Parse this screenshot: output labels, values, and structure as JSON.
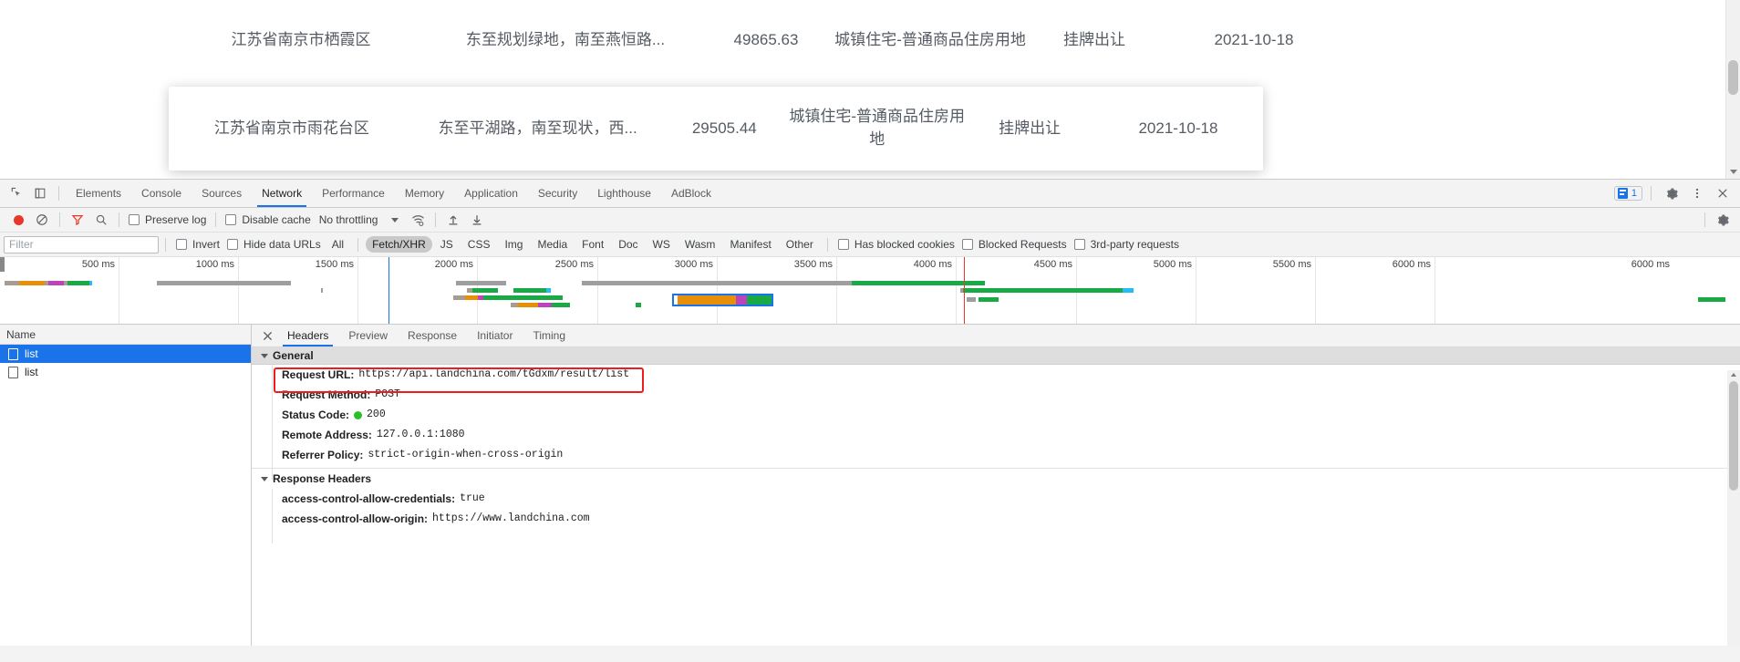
{
  "page": {
    "table": {
      "rows": [
        {
          "region": "江苏省南京市栖霞区",
          "description": "东至规划绿地，南至燕恒路...",
          "area": "49865.63",
          "usage": "城镇住宅-普通商品住房用地",
          "way": "挂牌出让",
          "date": "2021-10-18"
        },
        {
          "region": "江苏省南京市雨花台区",
          "description": "东至平湖路，南至现状，西...",
          "area": "29505.44",
          "usage": "城镇住宅-普通商品住房用地",
          "way": "挂牌出让",
          "date": "2021-10-18"
        }
      ]
    }
  },
  "devtools": {
    "tabs": [
      {
        "label": "Elements",
        "active": false
      },
      {
        "label": "Console",
        "active": false
      },
      {
        "label": "Sources",
        "active": false
      },
      {
        "label": "Network",
        "active": true
      },
      {
        "label": "Performance",
        "active": false
      },
      {
        "label": "Memory",
        "active": false
      },
      {
        "label": "Application",
        "active": false
      },
      {
        "label": "Security",
        "active": false
      },
      {
        "label": "Lighthouse",
        "active": false
      },
      {
        "label": "AdBlock",
        "active": false
      }
    ],
    "message_count": "1",
    "controls": {
      "record_title": "record-button",
      "clear_title": "clear-button",
      "filter_title": "filter-toggle",
      "search_title": "search-button",
      "preserve_log": "Preserve log",
      "disable_cache": "Disable cache",
      "throttling": "No throttling",
      "import_title": "import-har",
      "export_title": "export-har"
    },
    "filterbar": {
      "placeholder": "Filter",
      "invert": "Invert",
      "hide_data_urls": "Hide data URLs",
      "types": [
        {
          "label": "All",
          "active": false
        },
        {
          "label": "Fetch/XHR",
          "active": true
        },
        {
          "label": "JS",
          "active": false
        },
        {
          "label": "CSS",
          "active": false
        },
        {
          "label": "Img",
          "active": false
        },
        {
          "label": "Media",
          "active": false
        },
        {
          "label": "Font",
          "active": false
        },
        {
          "label": "Doc",
          "active": false
        },
        {
          "label": "WS",
          "active": false
        },
        {
          "label": "Wasm",
          "active": false
        },
        {
          "label": "Manifest",
          "active": false
        },
        {
          "label": "Other",
          "active": false
        }
      ],
      "has_blocked_cookies": "Has blocked cookies",
      "blocked_requests": "Blocked Requests",
      "third_party_requests": "3rd-party requests"
    },
    "overview": {
      "ticks": [
        "500 ms",
        "1000 ms",
        "1500 ms",
        "2000 ms",
        "2500 ms",
        "3000 ms",
        "3500 ms",
        "4000 ms",
        "4500 ms",
        "5000 ms",
        "5500 ms",
        "6000 ms"
      ]
    },
    "request_list": {
      "column_header": "Name",
      "rows": [
        {
          "name": "list",
          "selected": true
        },
        {
          "name": "list",
          "selected": false
        }
      ]
    },
    "detail": {
      "tabs": [
        {
          "label": "Headers",
          "active": true
        },
        {
          "label": "Preview",
          "active": false
        },
        {
          "label": "Response",
          "active": false
        },
        {
          "label": "Initiator",
          "active": false
        },
        {
          "label": "Timing",
          "active": false
        }
      ],
      "general": {
        "title": "General",
        "request_url_key": "Request URL:",
        "request_url_value": "https://api.landchina.com/tGdxm/result/list",
        "request_method_key": "Request Method:",
        "request_method_value": "POST",
        "status_code_key": "Status Code:",
        "status_code_value": "200",
        "remote_address_key": "Remote Address:",
        "remote_address_value": "127.0.0.1:1080",
        "referrer_policy_key": "Referrer Policy:",
        "referrer_policy_value": "strict-origin-when-cross-origin"
      },
      "response_headers": {
        "title": "Response Headers",
        "items": [
          {
            "key": "access-control-allow-credentials:",
            "value": "true"
          },
          {
            "key": "access-control-allow-origin:",
            "value": "https://www.landchina.com"
          }
        ]
      }
    },
    "colors": {
      "accent": "#1a73e8",
      "record": "#e8372b",
      "highlight": "#ee1c1c",
      "status_ok": "#2bc02b",
      "selected_row": "#1a73e8"
    }
  }
}
